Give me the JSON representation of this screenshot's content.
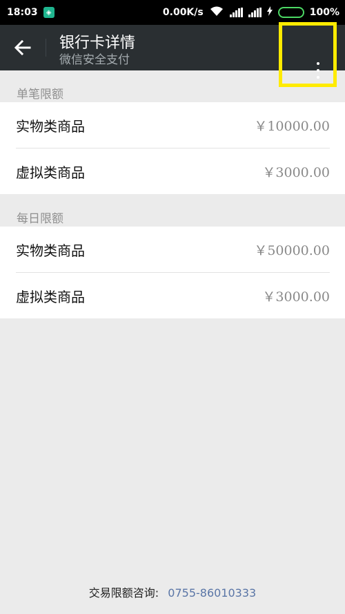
{
  "status_bar": {
    "time": "18:03",
    "network_speed": "0.00K/s",
    "battery_percent": "100%"
  },
  "app_bar": {
    "title": "银行卡详情",
    "subtitle": "微信安全支付"
  },
  "sections": [
    {
      "header": "单笔限额",
      "rows": [
        {
          "label": "实物类商品",
          "value": "￥10000.00"
        },
        {
          "label": "虚拟类商品",
          "value": "￥3000.00"
        }
      ]
    },
    {
      "header": "每日限额",
      "rows": [
        {
          "label": "实物类商品",
          "value": "￥50000.00"
        },
        {
          "label": "虚拟类商品",
          "value": "￥3000.00"
        }
      ]
    }
  ],
  "footer": {
    "label": "交易限额咨询:",
    "phone": "0755-86010333"
  },
  "colors": {
    "app_bar_bg": "#2a2f32",
    "highlight_box": "#ffeb00",
    "page_bg": "#ebebeb",
    "phone_link": "#5975a6"
  }
}
